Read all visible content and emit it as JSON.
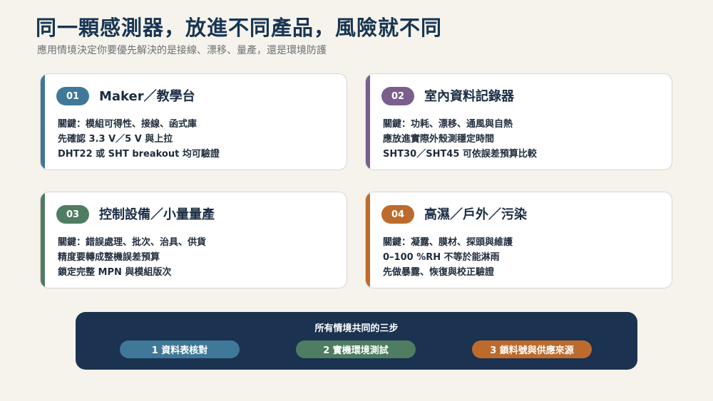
{
  "header": {
    "title": "同一顆感測器，放進不同產品，風險就不同",
    "subtitle": "應用情境決定你要優先解決的是接線、漂移、量產，還是環境防護"
  },
  "colors": {
    "blue": "#3f7898",
    "purple": "#7a5f8e",
    "green": "#4e7d61",
    "orange": "#bd6b2c",
    "navy": "#1b3250"
  },
  "cards": [
    {
      "badge": "01",
      "title": "Maker／教學台",
      "lines": [
        "關鍵：模組可得性、接線、函式庫",
        "先確認 3.3 V／5 V 與上拉",
        "DHT22 或 SHT breakout 均可驗證"
      ]
    },
    {
      "badge": "02",
      "title": "室內資料記錄器",
      "lines": [
        "關鍵：功耗、漂移、通風與自熱",
        "應放進實際外殼測穩定時間",
        "SHT30／SHT45 可依誤差預算比較"
      ]
    },
    {
      "badge": "03",
      "title": "控制設備／小量量產",
      "lines": [
        "關鍵：錯誤處理、批次、治具、供貨",
        "精度要轉成整機誤差預算",
        "鎖定完整 MPN 與模組版次"
      ]
    },
    {
      "badge": "04",
      "title": "高濕／戶外／污染",
      "lines": [
        "關鍵：凝露、膜材、探頭與維護",
        "0–100 %RH 不等於能淋雨",
        "先做暴露、恢復與校正驗證"
      ]
    }
  ],
  "footer": {
    "title": "所有情境共同的三步",
    "steps": [
      "1 資料表核對",
      "2 實機環境測試",
      "3 鎖料號與供應來源"
    ]
  }
}
